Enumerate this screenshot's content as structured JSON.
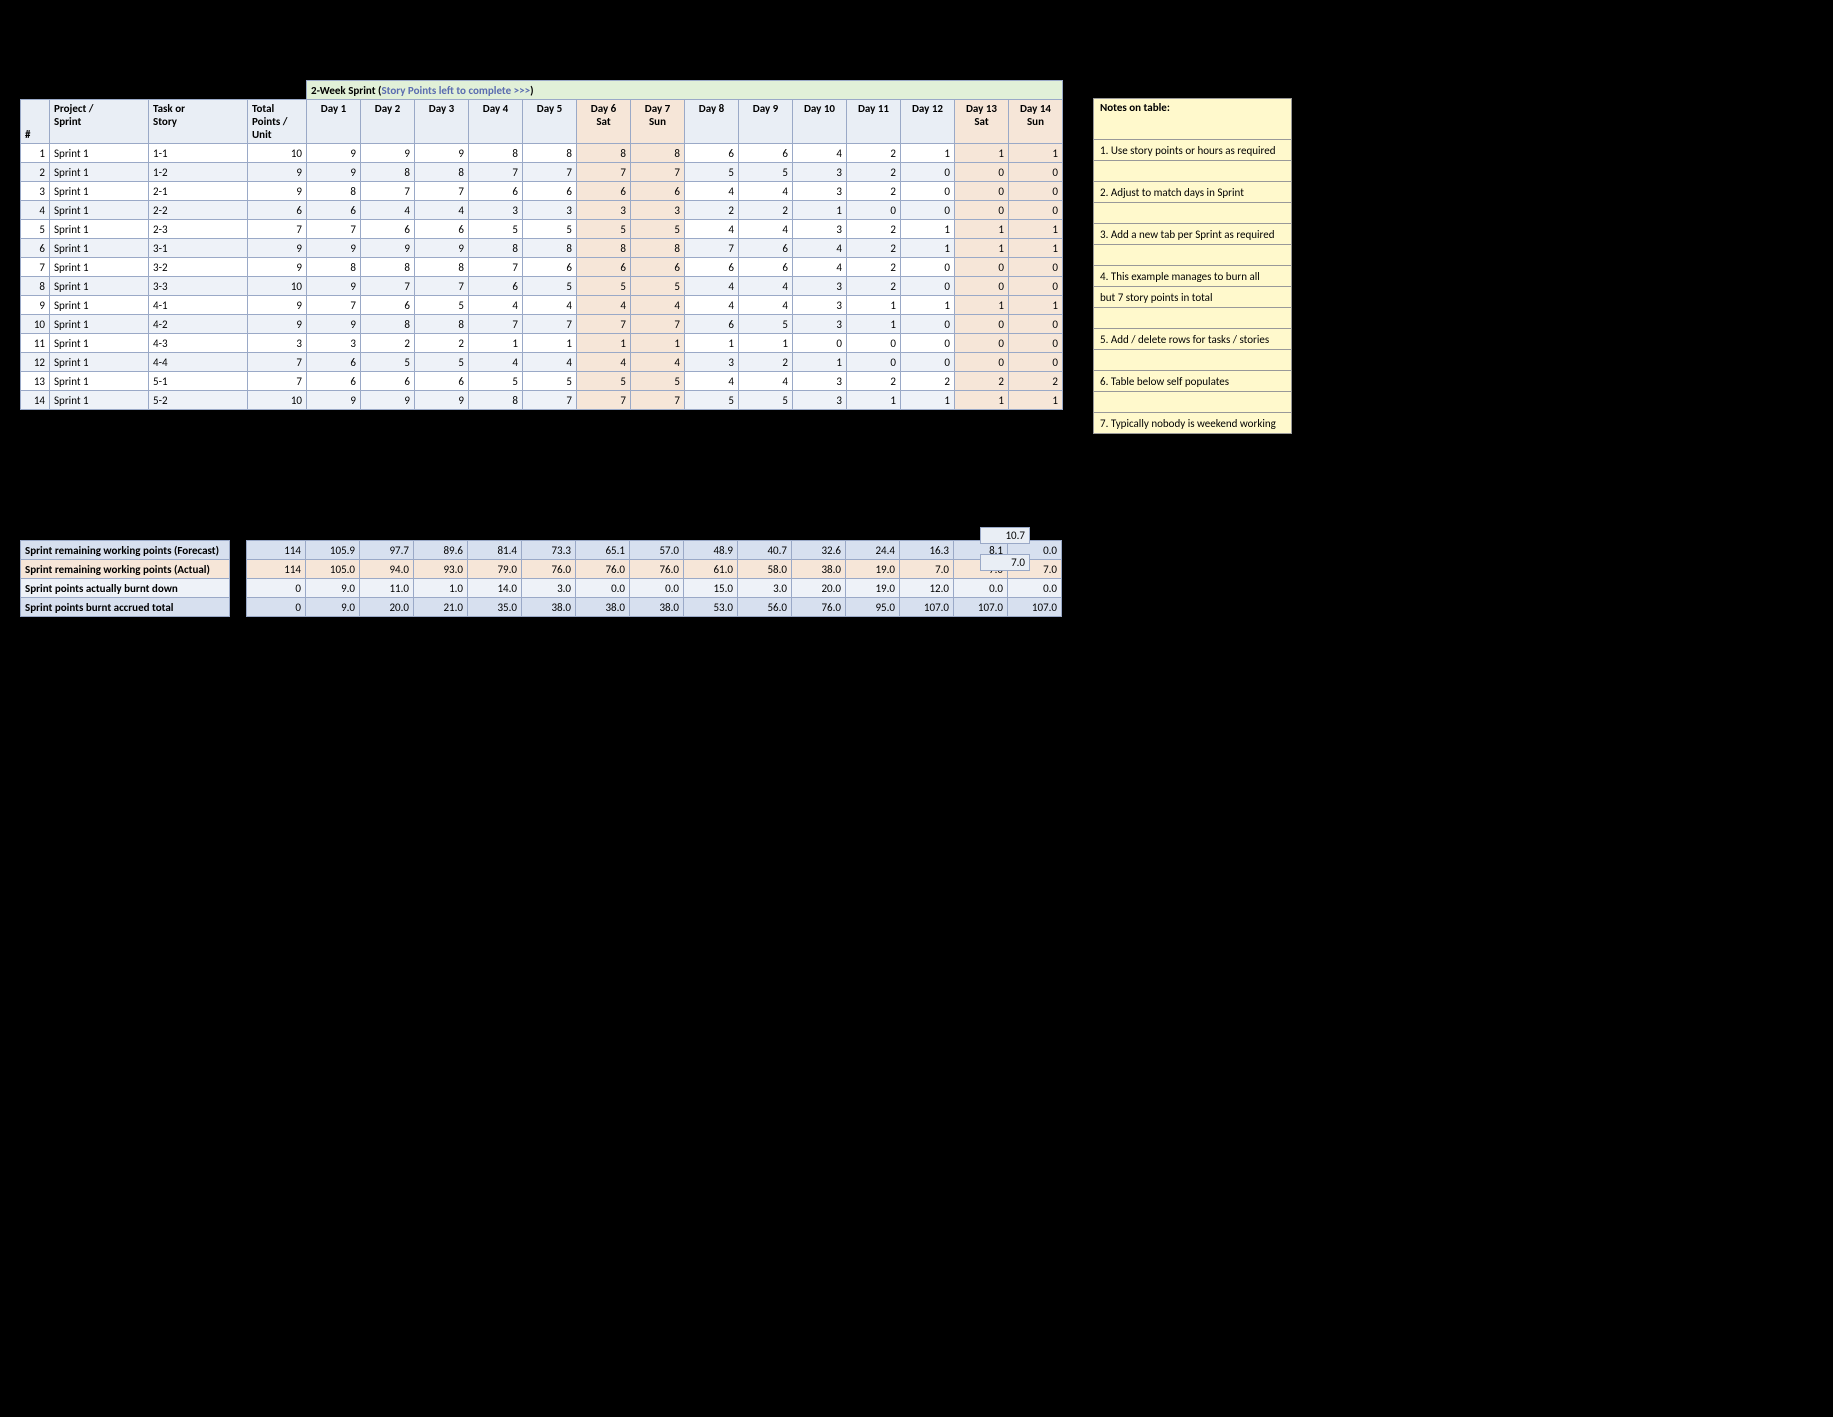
{
  "title_prefix": "2-Week Sprint (",
  "title_sub": "Story Points left to complete >>>",
  "title_suffix": ")",
  "headers": {
    "idx": "#",
    "project": "Project / Sprint",
    "task": "Task or Story",
    "points": "Total Points / Unit",
    "days": [
      "Day 1",
      "Day 2",
      "Day 3",
      "Day 4",
      "Day 5",
      "Day 6\nSat",
      "Day 7\nSun",
      "Day 8",
      "Day 9",
      "Day 10",
      "Day 11",
      "Day 12",
      "Day 13\nSat",
      "Day 14\nSun"
    ]
  },
  "weekend_cols": [
    5,
    6,
    12,
    13
  ],
  "rows": [
    {
      "idx": 1,
      "project": "Sprint 1",
      "task": "1-1",
      "points": 10,
      "days": [
        9,
        9,
        9,
        8,
        8,
        8,
        8,
        6,
        6,
        4,
        2,
        1,
        1,
        1
      ]
    },
    {
      "idx": 2,
      "project": "Sprint 1",
      "task": "1-2",
      "points": 9,
      "days": [
        9,
        8,
        8,
        7,
        7,
        7,
        7,
        5,
        5,
        3,
        2,
        0,
        0,
        0
      ]
    },
    {
      "idx": 3,
      "project": "Sprint 1",
      "task": "2-1",
      "points": 9,
      "days": [
        8,
        7,
        7,
        6,
        6,
        6,
        6,
        4,
        4,
        3,
        2,
        0,
        0,
        0
      ]
    },
    {
      "idx": 4,
      "project": "Sprint 1",
      "task": "2-2",
      "points": 6,
      "days": [
        6,
        4,
        4,
        3,
        3,
        3,
        3,
        2,
        2,
        1,
        0,
        0,
        0,
        0
      ]
    },
    {
      "idx": 5,
      "project": "Sprint 1",
      "task": "2-3",
      "points": 7,
      "days": [
        7,
        6,
        6,
        5,
        5,
        5,
        5,
        4,
        4,
        3,
        2,
        1,
        1,
        1
      ]
    },
    {
      "idx": 6,
      "project": "Sprint 1",
      "task": "3-1",
      "points": 9,
      "days": [
        9,
        9,
        9,
        8,
        8,
        8,
        8,
        7,
        6,
        4,
        2,
        1,
        1,
        1
      ]
    },
    {
      "idx": 7,
      "project": "Sprint 1",
      "task": "3-2",
      "points": 9,
      "days": [
        8,
        8,
        8,
        7,
        6,
        6,
        6,
        6,
        6,
        4,
        2,
        0,
        0,
        0
      ]
    },
    {
      "idx": 8,
      "project": "Sprint 1",
      "task": "3-3",
      "points": 10,
      "days": [
        9,
        7,
        7,
        6,
        5,
        5,
        5,
        4,
        4,
        3,
        2,
        0,
        0,
        0
      ]
    },
    {
      "idx": 9,
      "project": "Sprint 1",
      "task": "4-1",
      "points": 9,
      "days": [
        7,
        6,
        5,
        4,
        4,
        4,
        4,
        4,
        4,
        3,
        1,
        1,
        1,
        1
      ]
    },
    {
      "idx": 10,
      "project": "Sprint 1",
      "task": "4-2",
      "points": 9,
      "days": [
        9,
        8,
        8,
        7,
        7,
        7,
        7,
        6,
        5,
        3,
        1,
        0,
        0,
        0
      ]
    },
    {
      "idx": 11,
      "project": "Sprint 1",
      "task": "4-3",
      "points": 3,
      "days": [
        3,
        2,
        2,
        1,
        1,
        1,
        1,
        1,
        1,
        0,
        0,
        0,
        0,
        0
      ]
    },
    {
      "idx": 12,
      "project": "Sprint 1",
      "task": "4-4",
      "points": 7,
      "days": [
        6,
        5,
        5,
        4,
        4,
        4,
        4,
        3,
        2,
        1,
        0,
        0,
        0,
        0
      ]
    },
    {
      "idx": 13,
      "project": "Sprint 1",
      "task": "5-1",
      "points": 7,
      "days": [
        6,
        6,
        6,
        5,
        5,
        5,
        5,
        4,
        4,
        3,
        2,
        2,
        2,
        2
      ]
    },
    {
      "idx": 14,
      "project": "Sprint 1",
      "task": "5-2",
      "points": 10,
      "days": [
        9,
        9,
        9,
        8,
        7,
        7,
        7,
        5,
        5,
        3,
        1,
        1,
        1,
        1
      ]
    }
  ],
  "summary": [
    {
      "label": "Sprint remaining working points (Forecast)",
      "cls": "r1",
      "pts": "114",
      "days": [
        "105.9",
        "97.7",
        "89.6",
        "81.4",
        "73.3",
        "65.1",
        "57.0",
        "48.9",
        "40.7",
        "32.6",
        "24.4",
        "16.3",
        "8.1",
        "0.0"
      ]
    },
    {
      "label": "Sprint remaining working points (Actual)",
      "cls": "r2",
      "pts": "114",
      "days": [
        "105.0",
        "94.0",
        "93.0",
        "79.0",
        "76.0",
        "76.0",
        "76.0",
        "61.0",
        "58.0",
        "38.0",
        "19.0",
        "7.0",
        "7.0",
        "7.0"
      ]
    },
    {
      "label": "Sprint points actually burnt down",
      "cls": "r3",
      "pts": "0",
      "days": [
        "9.0",
        "11.0",
        "1.0",
        "14.0",
        "3.0",
        "0.0",
        "0.0",
        "15.0",
        "3.0",
        "20.0",
        "19.0",
        "12.0",
        "0.0",
        "0.0"
      ]
    },
    {
      "label": "Sprint points burnt accrued total",
      "cls": "r4",
      "pts": "0",
      "days": [
        "9.0",
        "20.0",
        "21.0",
        "35.0",
        "38.0",
        "38.0",
        "38.0",
        "53.0",
        "56.0",
        "76.0",
        "95.0",
        "107.0",
        "107.0",
        "107.0"
      ]
    }
  ],
  "notes_header": "Notes on table:",
  "notes": [
    "1. Use story points or hours as required",
    "",
    "2. Adjust to match days in Sprint",
    "",
    "3. Add a new tab per Sprint as required",
    "",
    "4. This example manages to burn all",
    "but 7 story points in total",
    "",
    "5. Add / delete rows for tasks / stories",
    "",
    "6. Table below self populates",
    "",
    "7. Typically nobody is weekend working"
  ],
  "floaters": [
    "10.7",
    "7.0"
  ]
}
